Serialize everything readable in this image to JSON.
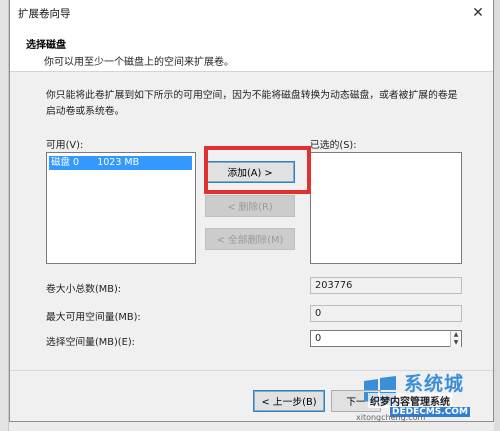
{
  "window": {
    "title": "扩展卷向导",
    "close_glyph": "✕"
  },
  "header": {
    "title": "选择磁盘",
    "subtitle": "你可以用至少一个磁盘上的空间来扩展卷。"
  },
  "description": "你只能将此卷扩展到如下所示的可用空间，因为不能将磁盘转换为动态磁盘，或者被扩展的卷是启动卷或系统卷。",
  "available": {
    "label": "可用(V):",
    "items": [
      {
        "disk": "磁盘 0",
        "size": "1023 MB"
      }
    ]
  },
  "selected": {
    "label": "已选的(S):"
  },
  "buttons": {
    "add": "添加(A) >",
    "remove": "< 删除(R)",
    "remove_all": "< 全部删除(M)",
    "back": "< 上一步(B)",
    "next": "下一"
  },
  "fields": {
    "total_label": "卷大小总数(MB):",
    "total_value": "203776",
    "max_label": "最大可用空间量(MB):",
    "max_value": "0",
    "select_label": "选择空间量(MB)(E):",
    "select_value": "0"
  },
  "watermark": {
    "brand": "系统城",
    "site_name": "织梦内容管理系统",
    "site_domain": "DEDECMS.COM",
    "url": "xitongcheng.com"
  },
  "colors": {
    "highlight_red": "#e03030",
    "selection_blue": "#3399ff",
    "watermark_blue": "#3a8fd8"
  }
}
